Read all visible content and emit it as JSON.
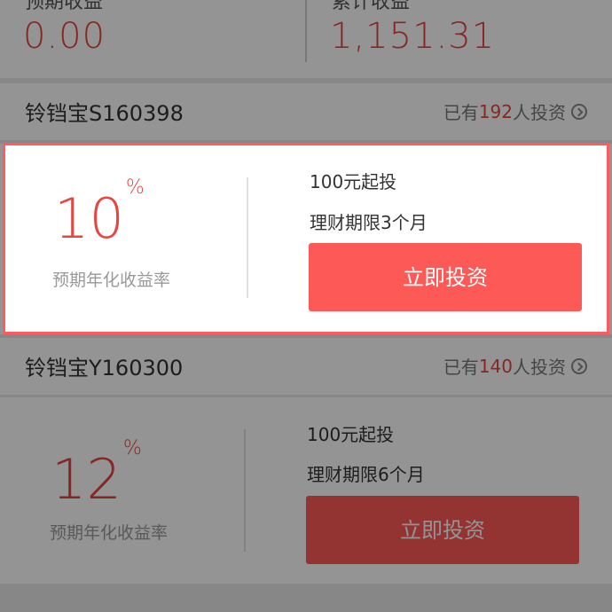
{
  "stats": {
    "left_label": "预期收益",
    "left_value": "0.00",
    "right_label": "累计收益",
    "right_value": "1,151.31"
  },
  "products": [
    {
      "name": "铃铛宝S160398",
      "investors_prefix": "已有",
      "investors_count": "192",
      "investors_suffix": "人投资",
      "rate": "10",
      "rate_unit": "%",
      "rate_label": "预期年化收益率",
      "min_invest": "100元起投",
      "term": "理财期限3个月",
      "button_label": "立即投资"
    },
    {
      "name": "铃铛宝Y160300",
      "investors_prefix": "已有",
      "investors_count": "140",
      "investors_suffix": "人投资",
      "rate": "12",
      "rate_unit": "%",
      "rate_label": "预期年化收益率",
      "min_invest": "100元起投",
      "term": "理财期限6个月",
      "button_label": "立即投资"
    }
  ],
  "colors": {
    "accent": "#e5463f",
    "button": "#fd5a57",
    "highlight_border": "#ff5a5f"
  },
  "icons": {
    "investors_chevron": "chevron-right-circle-icon"
  }
}
